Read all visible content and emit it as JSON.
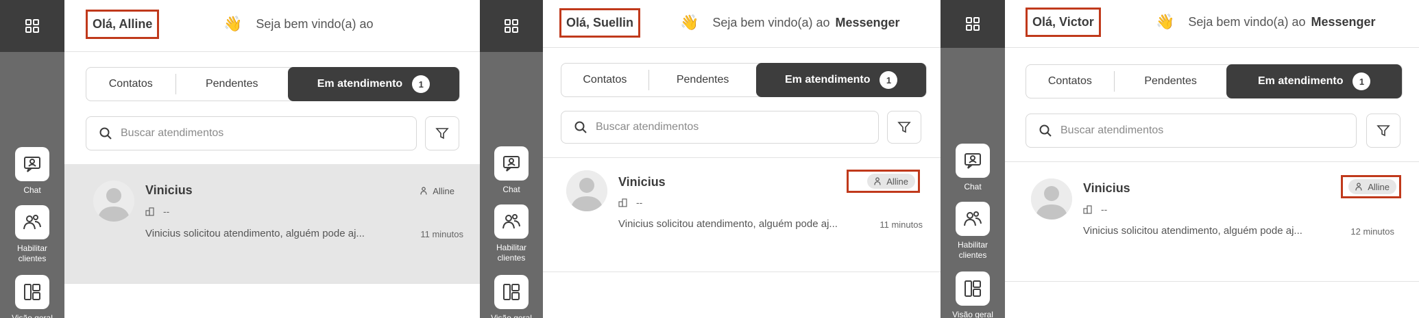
{
  "sidebar": {
    "items": [
      {
        "label": "Chat",
        "icon": "chat-icon"
      },
      {
        "label": "Habilitar clientes",
        "icon": "users-icon"
      },
      {
        "label": "Visão geral",
        "icon": "dashboard-icon"
      }
    ],
    "menu_icon": "grid-icon"
  },
  "screens": [
    {
      "greeting": "Olá, Alline",
      "welcome": "Seja bem vindo(a) ao",
      "brand": "",
      "tabs": {
        "contacts": "Contatos",
        "pending": "Pendentes",
        "in_service": "Em atendimento",
        "badge": "1"
      },
      "search_placeholder": "Buscar atendimentos",
      "item": {
        "name": "Vinicius",
        "agent": "Alline",
        "sub": "--",
        "message": "Vinicius solicitou atendimento, alguém pode aj...",
        "time": "11 minutos"
      }
    },
    {
      "greeting": "Olá, Suellin",
      "welcome": "Seja bem vindo(a) ao",
      "brand": "Messenger",
      "tabs": {
        "contacts": "Contatos",
        "pending": "Pendentes",
        "in_service": "Em atendimento",
        "badge": "1"
      },
      "search_placeholder": "Buscar atendimentos",
      "item": {
        "name": "Vinicius",
        "agent": "Alline",
        "sub": "--",
        "message": "Vinicius solicitou atendimento, alguém pode aj...",
        "time": "11 minutos"
      }
    },
    {
      "greeting": "Olá, Victor",
      "welcome": "Seja bem vindo(a) ao",
      "brand": "Messenger",
      "tabs": {
        "contacts": "Contatos",
        "pending": "Pendentes",
        "in_service": "Em atendimento",
        "badge": "1"
      },
      "search_placeholder": "Buscar atendimentos",
      "item": {
        "name": "Vinicius",
        "agent": "Alline",
        "sub": "--",
        "message": "Vinicius solicitou atendimento, alguém pode aj...",
        "time": "12 minutos"
      }
    }
  ],
  "colors": {
    "sidebar_dark": "#3d3d3d",
    "sidebar": "#6a6a6a",
    "highlight": "#c0391b",
    "active_tab": "#3d3d3d",
    "selected_row": "#e6e6e6"
  }
}
